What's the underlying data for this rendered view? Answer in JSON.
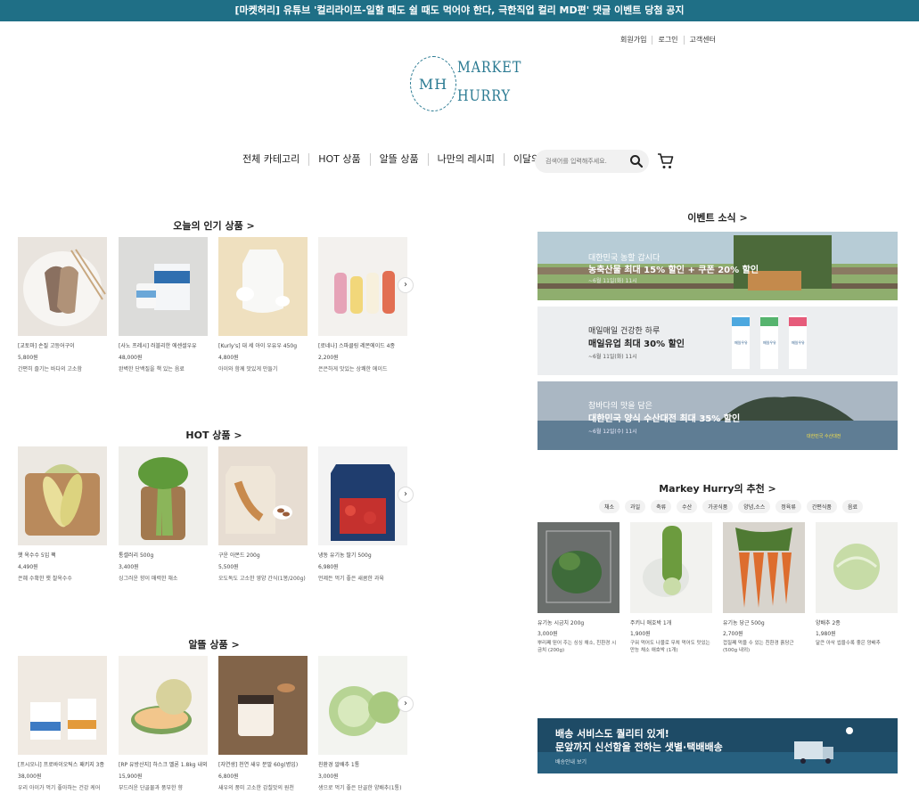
{
  "announcement": "[마켓허리] 유튜브 '컬리라이프-일할 때도 쉴 때도 먹어야 한다, 극한직업 컬리 MD편' 댓글 이벤트 당첨 공지",
  "util_links": [
    "회원가입",
    "로그인",
    "고객센터"
  ],
  "logo": {
    "mark": "MH",
    "line1": "MARKET",
    "line2": "HURRY"
  },
  "nav": [
    "전체 카테고리",
    "HOT 상품",
    "알뜰 상품",
    "나만의 레시피",
    "이달의 이벤트"
  ],
  "search": {
    "placeholder": "검색어를 입력해주세요."
  },
  "sections": {
    "popular": {
      "title": "오늘의 인기 상품 >"
    },
    "hot": {
      "title": "HOT 상품 >"
    },
    "bargain": {
      "title": "알뜰 상품 >"
    },
    "events": {
      "title": "이벤트 소식 >"
    },
    "recommend": {
      "title": "Markey Hurry의 추천 >"
    }
  },
  "popular_products": [
    {
      "name": "[교토마] 손질 고등어구이",
      "price": "5,800원",
      "desc": "간편히 즐기는 바다의 고소함"
    },
    {
      "name": "[사노 프레시] 러블리한 에센셜우유",
      "price": "48,000원",
      "desc": "완벽한 단백질을 책 있는 음료"
    },
    {
      "name": "[Kurly's] 대 세 아이 우유우 450g",
      "price": "4,800원",
      "desc": "아이와 함께 맛있게 만들기"
    },
    {
      "name": "[로네나] 스파클링 레몬에이드 4종",
      "price": "2,200원",
      "desc": "은은하게 맛있는 상쾌한 에이드"
    }
  ],
  "hot_products": [
    {
      "name": "햇 옥수수 5입 팩",
      "price": "4,490원",
      "desc": "은혜 수확한 햇 찰옥수수"
    },
    {
      "name": "통셀러리 500g",
      "price": "3,400원",
      "desc": "싱그러운 향이 매력한 채소"
    },
    {
      "name": "구운 아몬드 200g",
      "price": "5,500원",
      "desc": "오도독도 고소한 영양 간식(1봉/200g)"
    },
    {
      "name": "냉동 유기농 딸기 500g",
      "price": "6,980원",
      "desc": "언제든 먹기 좋은 새콤한 과육"
    }
  ],
  "bargain_products": [
    {
      "name": "[프시오니] 프로바이오틱스 패키지 3종",
      "price": "38,000원",
      "desc": "우리 아이가 먹기 좋아하는 건강 케어"
    },
    {
      "name": "[RP 유방산지] 하스크 멜론 1.8kg 내외",
      "price": "15,900원",
      "desc": "부드러운 단골물과 풍부한 향"
    },
    {
      "name": "[자연생] 천연 새우 분말 60g(병입)",
      "price": "6,800원",
      "desc": "새우의 풍미 고소한 감칠맛의 원천"
    },
    {
      "name": "친환경 알배추 1통",
      "price": "3,000원",
      "desc": "생으로 먹기 좋은 단골한 양배추(1통)"
    }
  ],
  "event_banners": [
    {
      "line1": "대한민국 농할 갑시다",
      "line2": "농축산물 최대 15% 할인 + 쿠폰 20% 할인",
      "line3": "~6월 11일(화) 11시"
    },
    {
      "line1": "매일매일 건강한 하루",
      "line2": "매일유업 최대 30% 할인",
      "line3": "~6월 11일(화) 11시"
    },
    {
      "line1": "참바다의 맛을 담은",
      "line2": "대한민국 양식 수산대전 최대 35% 할인",
      "line3": "~6월 12일(수) 11시"
    }
  ],
  "banner_milk_label": "매일우유",
  "banner_seafood_badge": "대한민국 수산대전",
  "recommend_tabs": [
    "채소",
    "과일",
    "축류",
    "수산",
    "가공식품",
    "양념,소스",
    "정육류",
    "간편식품",
    "음료"
  ],
  "recommend_products": [
    {
      "name": "유기농 시금치 200g",
      "price": "3,000원",
      "desc": "뿌리째 믿어 주는 싱싱 채소, 친환경 시금치 (200g)"
    },
    {
      "name": "주키니 애호박 1개",
      "price": "1,900원",
      "desc": "구워 먹어도 나물로 무쳐 먹어도 맛있는 만능 채소 애호박 (1개)"
    },
    {
      "name": "유기농 당근 500g",
      "price": "2,700원",
      "desc": "껍질째 먹을 수 있는 친환경 흙당근 (500g 내외)"
    },
    {
      "name": "양배추 2종",
      "price": "1,980원",
      "desc": "달큰 아삭 씹을수록 좋은 양배추"
    }
  ],
  "delivery": {
    "title1": "배송 서비스도 퀄리티 있게!",
    "title2": "문앞까지 신선함을 전하는 샛별·택배배송",
    "link": "배송안내 보기"
  },
  "colors": {
    "brand": "#1f6f86",
    "logo": "#2a7a92"
  }
}
